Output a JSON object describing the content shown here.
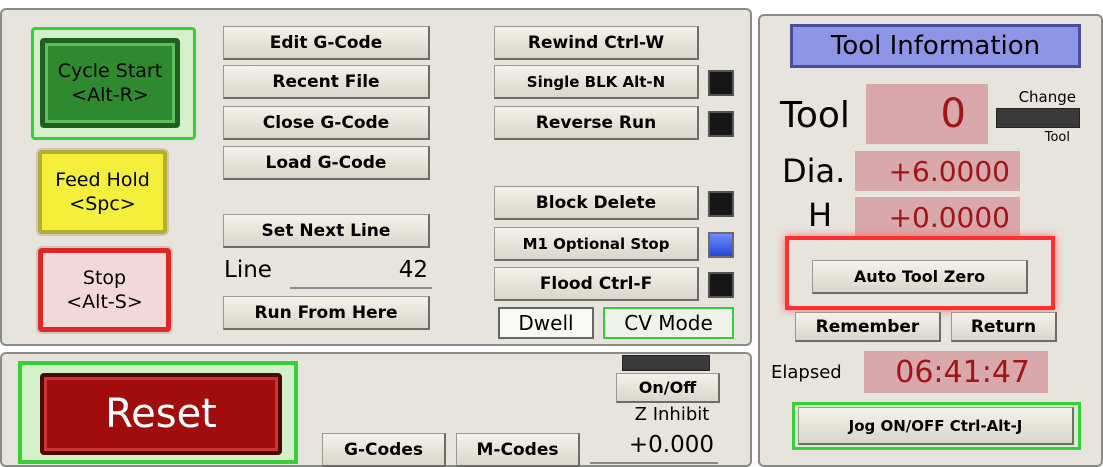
{
  "program": {
    "cycle_start": {
      "line1": "Cycle Start",
      "line2": "<Alt-R>"
    },
    "feed_hold": {
      "line1": "Feed Hold",
      "line2": "<Spc>"
    },
    "stop": {
      "line1": "Stop",
      "line2": "<Alt-S>"
    },
    "edit_gcode": "Edit G-Code",
    "recent_file": "Recent File",
    "close_gcode": "Close G-Code",
    "load_gcode": "Load G-Code",
    "set_next_line": "Set Next Line",
    "line_label": "Line",
    "line_value": "42",
    "run_from_here": "Run From Here",
    "rewind": "Rewind Ctrl-W",
    "single_blk": "Single BLK Alt-N",
    "reverse_run": "Reverse Run",
    "block_delete": "Block Delete",
    "m1_optional_stop": "M1 Optional Stop",
    "flood": "Flood Ctrl-F",
    "dwell": "Dwell",
    "cv_mode": "CV Mode"
  },
  "bottom": {
    "reset": "Reset",
    "gcodes": "G-Codes",
    "mcodes": "M-Codes",
    "onoff": "On/Off",
    "z_inhibit_label": "Z Inhibit",
    "z_inhibit_value": "+0.000"
  },
  "tool": {
    "title": "Tool Information",
    "tool_label": "Tool",
    "tool_value": "0",
    "change_label_top": "Change",
    "change_label_bottom": "Tool",
    "dia_label": "Dia.",
    "dia_value": "+6.0000",
    "h_label": "H",
    "h_value": "+0.0000",
    "auto_tool_zero": "Auto Tool Zero",
    "remember": "Remember",
    "return": "Return",
    "elapsed_label": "Elapsed",
    "elapsed_value": "06:41:47",
    "jog": "Jog ON/OFF Ctrl-Alt-J"
  },
  "colors": {
    "panel_bg": "#e6e4dd",
    "readout_bg": "#d8a8aa",
    "readout_text": "#a0141a",
    "highlight": "#ff3030",
    "cycle_green": "#2e8a2e",
    "feed_yellow": "#f3ef3a",
    "stop_red": "#e83030",
    "reset_red": "#a10d0d",
    "title_blue": "#8f95e6"
  }
}
